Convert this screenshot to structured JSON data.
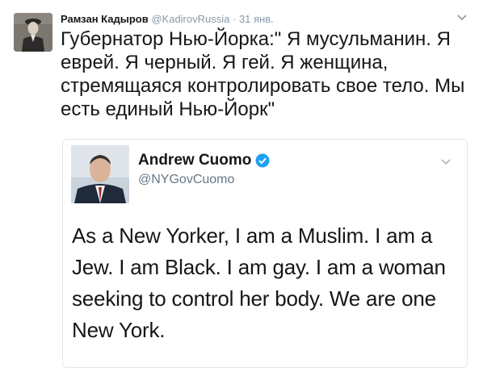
{
  "tweet": {
    "author_name": "Рамзан Кадыров",
    "author_handle": "@KadirovRussia",
    "separator": "·",
    "time": "31 янв.",
    "text": "Губернатор Нью-Йорка:\" Я мусульманин. Я еврей. Я черный. Я гей. Я женщина, стремящаяся контролировать свое тело. Мы есть единый Нью-Йорк\"",
    "avatar_icon": "user-avatar",
    "menu_icon": "chevron-down-icon"
  },
  "quoted_tweet": {
    "author_name": "Andrew Cuomo",
    "author_handle": "@NYGovCuomo",
    "verified_icon": "verified-badge-icon",
    "verified_color": "#1da1f2",
    "text": "As a New Yorker, I am a Muslim. I am a Jew. I am Black. I am gay. I am a woman seeking to control her body. We are one New York.",
    "menu_icon": "chevron-down-icon"
  },
  "colors": {
    "text_primary": "#14171a",
    "text_secondary": "#8899a6",
    "border": "#e1e8ed",
    "accent": "#1da1f2"
  }
}
